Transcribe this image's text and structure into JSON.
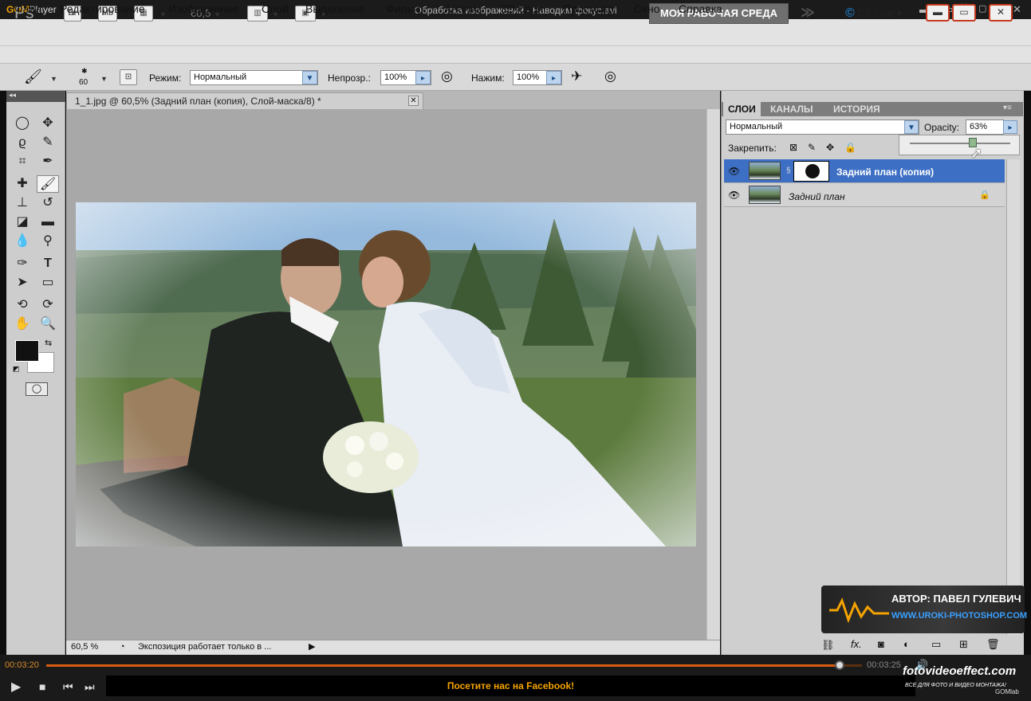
{
  "player": {
    "logo": "GOM",
    "logo2": "Player",
    "title": "Обработка изображений - Наводим фокус.avi",
    "elapsed": "00:03:20",
    "total": "00:03:25",
    "banner": "Посетите нас на Facebook!",
    "fv_site": "fotovideoeffect.com",
    "fv_tagline": "ВСЕ ДЛЯ ФОТО И ВИДЕО МОНТАЖА!",
    "gomlab": "GOMlab"
  },
  "appbar": {
    "logo": "Ps",
    "br": "Br",
    "mb": "Mb",
    "zoom": "60,5",
    "workspace": "МОЯ РАБОЧАЯ СРЕДА",
    "cslive": "CS Live"
  },
  "menu": [
    "Файл",
    "Редактирование",
    "Изображение",
    "Слой",
    "Выделение",
    "Фильтр",
    "Анализ",
    "3D-слои",
    "Просмотр",
    "Окно",
    "Справка"
  ],
  "options": {
    "brush_size": "60",
    "mode_label": "Режим:",
    "mode_value": "Нормальный",
    "opacity_label": "Непрозр.:",
    "opacity_value": "100%",
    "flow_label": "Нажим:",
    "flow_value": "100%"
  },
  "document": {
    "tab": "1_1.jpg @ 60,5% (Задний план (копия), Слой-маска/8) *",
    "zoom": "60,5 %",
    "status": "Экспозиция работает только в ..."
  },
  "layers_panel": {
    "tabs": [
      "СЛОИ",
      "КАНАЛЫ",
      "ИСТОРИЯ"
    ],
    "blend": "Нормальный",
    "opacity_label": "Opacity:",
    "opacity_value": "63%",
    "lock_label": "Закрепить:",
    "layers": [
      {
        "name": "Задний план (копия)",
        "selected": true
      },
      {
        "name": "Задний план",
        "selected": false
      }
    ]
  },
  "watermark": {
    "author": "АВТОР: ПАВЕЛ ГУЛЕВИЧ",
    "url": "WWW.UROKI-PHOTOSHOP.COM"
  },
  "colors": {
    "accent": "#d65d12",
    "layer_selected": "#3d6fc4",
    "gom_orange": "#f5a300"
  }
}
